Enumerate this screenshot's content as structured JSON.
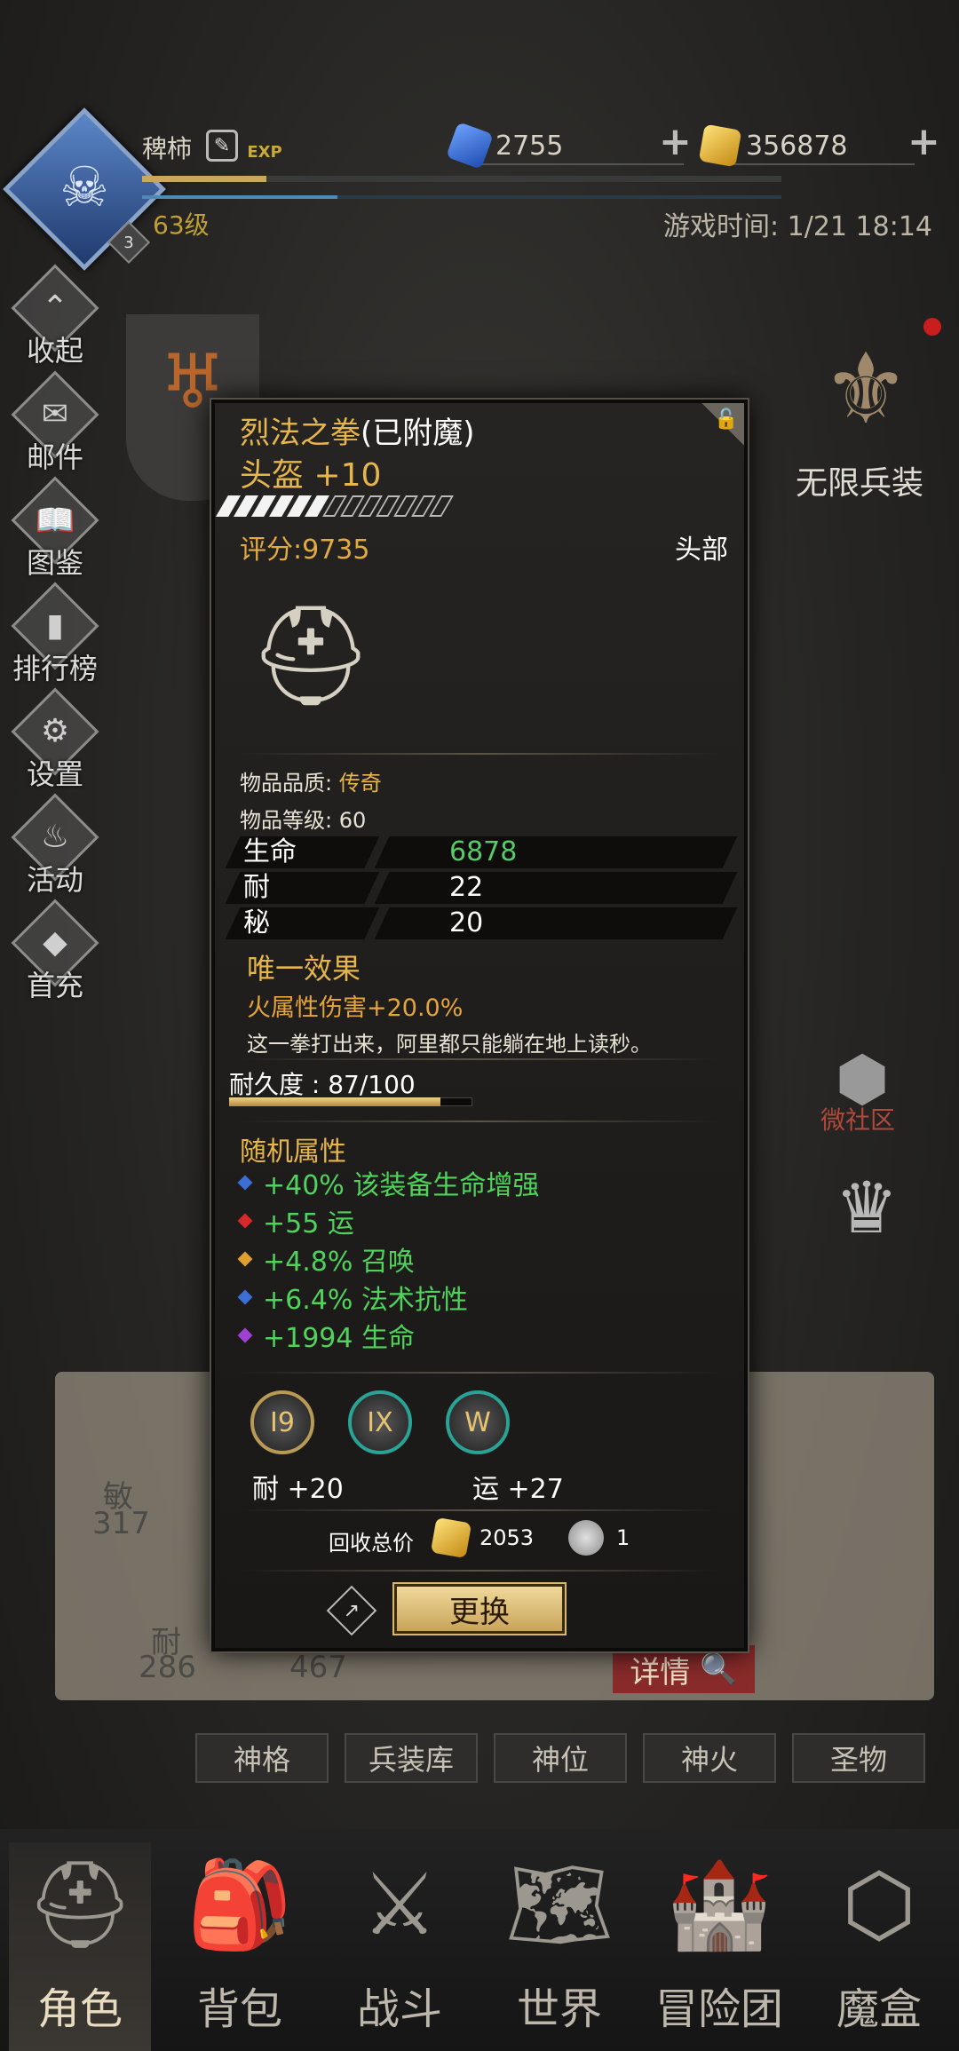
{
  "header": {
    "player_name": "稗柿",
    "avatar_badge": "3",
    "level": "63级",
    "game_time": "游戏时间: 1/21 18:14",
    "exp_icon_text": "EXP"
  },
  "currency": {
    "diamonds": "2755",
    "gold": "356878"
  },
  "side_menu": [
    {
      "label": "收起",
      "icon": "collapse-icon"
    },
    {
      "label": "邮件",
      "icon": "mail-icon"
    },
    {
      "label": "图鉴",
      "icon": "book-icon"
    },
    {
      "label": "排行榜",
      "icon": "ranking-icon"
    },
    {
      "label": "设置",
      "icon": "gear-icon"
    },
    {
      "label": "活动",
      "icon": "event-icon"
    },
    {
      "label": "首充",
      "icon": "first-recharge-icon"
    }
  ],
  "right_side": {
    "infinite_gear": "无限兵装",
    "community": "微社区"
  },
  "item": {
    "name": "烈法之拳",
    "name_suffix": "(已附魔)",
    "type_line": "头盔 +10",
    "score": "评分:9735",
    "slot": "头部",
    "stars_filled": 6,
    "stars_total": 13,
    "quality_label": "物品品质: ",
    "quality_value": "传奇",
    "item_level": "物品等级:  60",
    "stats": [
      {
        "name": "生命",
        "value": "6878",
        "green": true
      },
      {
        "name": "耐",
        "value": "22",
        "green": false
      },
      {
        "name": "秘",
        "value": "20",
        "green": false
      }
    ],
    "unique_title": "唯一效果",
    "unique_effect": "火属性伤害+20.0%",
    "flavor": "这一拳打出来，阿里都只能躺在地上读秒。",
    "durability": "耐久度 : 87/100",
    "durability_fraction": 0.87,
    "random_title": "随机属性",
    "random_attrs": [
      {
        "text": "+40% 该装备生命增强",
        "gem_color": "#3b6fd6"
      },
      {
        "text": "+55 运",
        "gem_color": "#d62a2a"
      },
      {
        "text": "+4.8% 召唤",
        "gem_color": "#e0a030"
      },
      {
        "text": "+6.4% 法术抗性",
        "gem_color": "#3b6fd6"
      },
      {
        "text": "+1994 生命",
        "gem_color": "#a040d0"
      }
    ],
    "sockets": [
      "I9",
      "IX",
      "W"
    ],
    "socket_bonus_1": "耐  +20",
    "socket_bonus_2": "运  +27",
    "recycle_label": "回收总价",
    "recycle_gold": "2053",
    "recycle_stone": "1",
    "swap_button": "更换"
  },
  "background_stats": {
    "agi_label": "敏",
    "agi_value": "317",
    "end_label": "耐",
    "end_value": "286",
    "other_value": "467"
  },
  "detail_button": "详情",
  "sub_tabs": [
    "神格",
    "兵装库",
    "神位",
    "神火",
    "圣物"
  ],
  "nav": [
    {
      "label": "角色",
      "icon": "helmet-icon",
      "active": true
    },
    {
      "label": "背包",
      "icon": "backpack-icon",
      "active": false
    },
    {
      "label": "战斗",
      "icon": "sword-shield-icon",
      "active": false
    },
    {
      "label": "世界",
      "icon": "map-icon",
      "active": false
    },
    {
      "label": "冒险团",
      "icon": "castle-icon",
      "active": false
    },
    {
      "label": "魔盒",
      "icon": "cube-icon",
      "active": false
    }
  ],
  "colors": {
    "gold_text": "#e6b54c",
    "green_text": "#4fd35c",
    "legendary": "#e6b54c"
  }
}
